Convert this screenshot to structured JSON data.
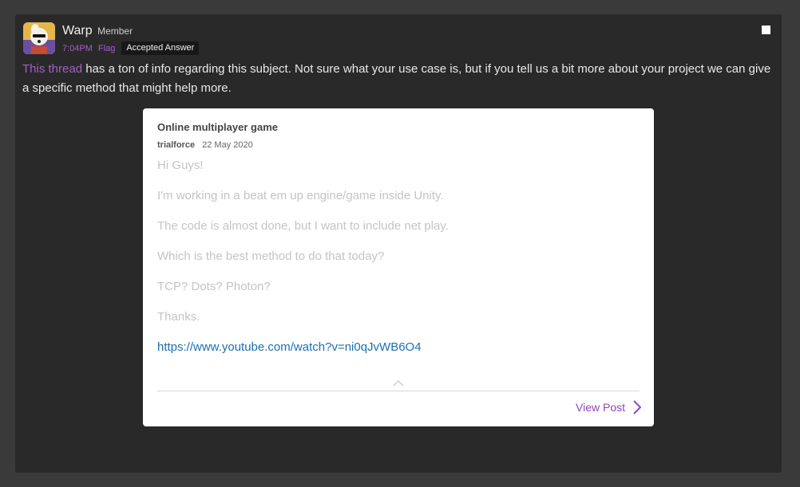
{
  "post": {
    "username": "Warp",
    "role": "Member",
    "time": "7:04PM",
    "flag_label": "Flag",
    "badge": "Accepted Answer",
    "message_link": "This thread",
    "message_rest": " has a ton of info regarding this subject. Not sure what your use case is, but if you tell us a bit more about your project we can give a specific method that might help more."
  },
  "embed": {
    "title": "Online multiplayer game",
    "author": "trialforce",
    "date": "22 May 2020",
    "lines": [
      "Hi Guys!",
      "I'm working in a beat em up engine/game inside Unity.",
      "The code is almost done, but I want to include net play.",
      "Which is the best method to do that today?",
      "TCP? Dots? Photon?",
      "Thanks."
    ],
    "link": "https://www.youtube.com/watch?v=ni0qJvWB6O4",
    "view_post_label": "View Post"
  },
  "colors": {
    "accent": "#a45fc9",
    "panel": "#292929",
    "link_blue": "#1a6fb0"
  }
}
